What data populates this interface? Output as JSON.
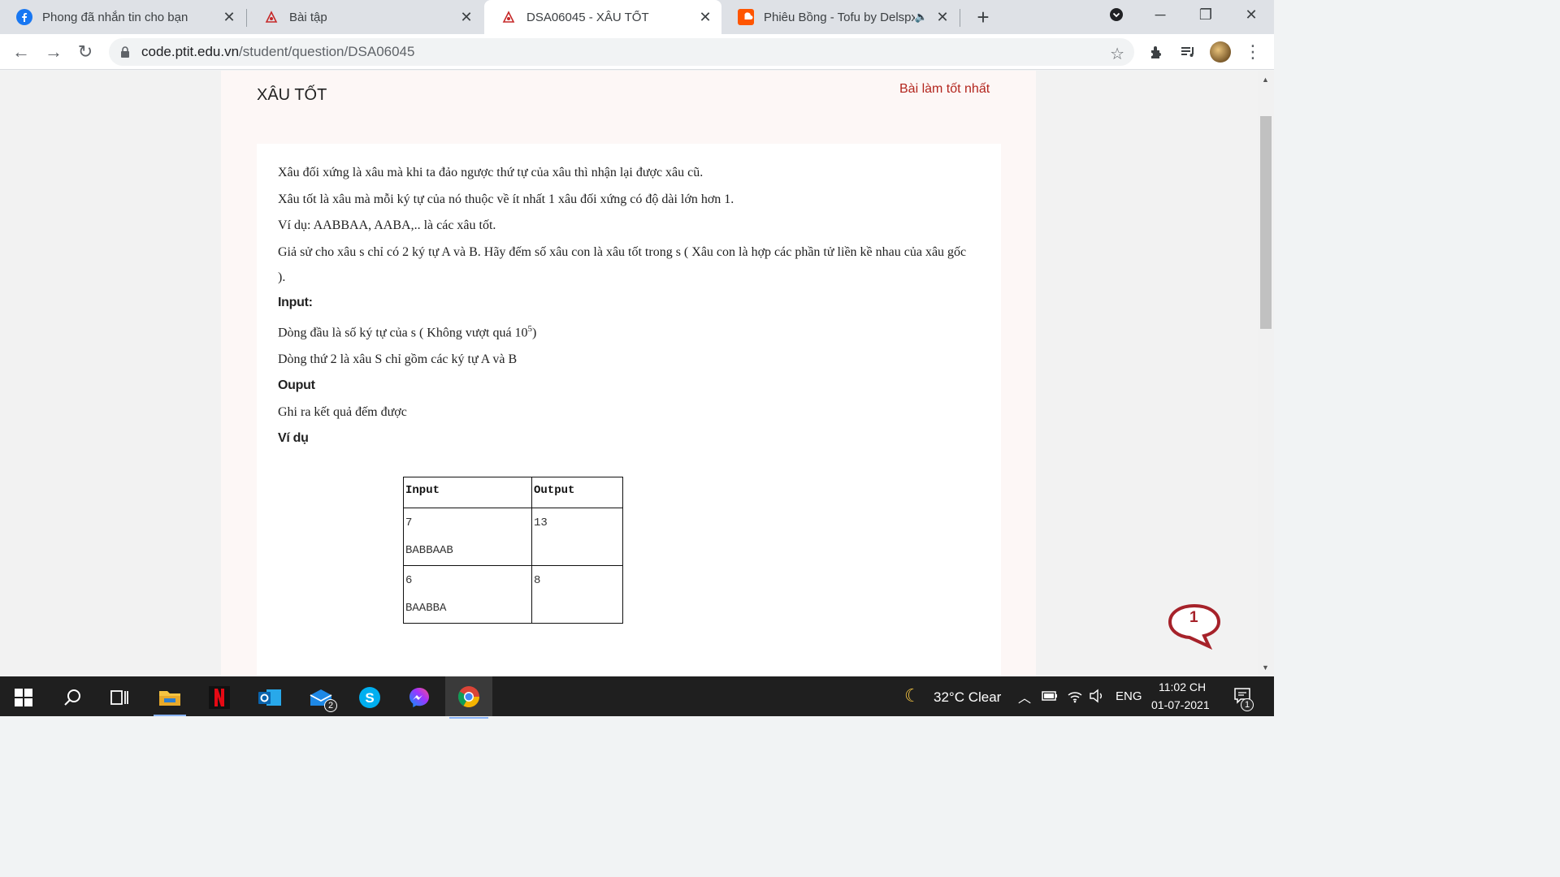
{
  "browser": {
    "tabs": [
      {
        "title": "Phong đã nhắn tin cho bạn",
        "icon": "facebook-icon"
      },
      {
        "title": "Bài tập",
        "icon": "ptit-icon"
      },
      {
        "title": "DSA06045 - XÂU TỐT",
        "icon": "ptit-icon",
        "active": true
      },
      {
        "title": "Phiêu Bồng - Tofu by Delspx",
        "icon": "soundcloud-icon"
      }
    ],
    "url_host": "code.ptit.edu.vn",
    "url_path": "/student/question/DSA06045"
  },
  "page": {
    "title": "XÂU TỐT",
    "best_link": "Bài làm tốt nhất",
    "paragraphs": {
      "p1": "Xâu đối xứng là xâu mà khi ta đảo ngược thứ tự của xâu thì nhận lại được xâu cũ.",
      "p2": "Xâu tốt là xâu mà mỗi ký tự của nó thuộc về ít nhất 1 xâu đối xứng có độ dài lớn hơn 1.",
      "p3": "Ví dụ: AABBAA,  AABA,.. là các xâu tốt.",
      "p4": "Giả sử cho xâu s chỉ có 2 ký tự A và B. Hãy đếm số xâu con là xâu tốt trong s ( Xâu con là hợp các phần tử liền kề nhau của xâu gốc )."
    },
    "input_heading": "Input:",
    "input_line1_pre": "Dòng đầu là số ký tự của s ( Không vượt quá 10",
    "input_line1_sup": "5",
    "input_line1_post": ")",
    "input_line2": "Dòng thứ 2 là xâu S chỉ gồm các ký tự A và B",
    "output_heading": "Ouput",
    "output_line": "Ghi ra kết quả đếm được",
    "example_heading": "Ví dụ",
    "table": {
      "headers": [
        "Input",
        "Output"
      ],
      "rows": [
        {
          "input": [
            "7",
            "BABBAAB"
          ],
          "output": "13"
        },
        {
          "input": [
            "6",
            "BAABBA"
          ],
          "output": "8"
        }
      ]
    },
    "chat_count": "1"
  },
  "taskbar": {
    "mail_badge": "2",
    "weather": "32°C  Clear",
    "language": "ENG",
    "time": "11:02 CH",
    "date": "01-07-2021",
    "notification_count": "1"
  },
  "colors": {
    "accent_red": "#b3261e",
    "tab_strip": "#dee1e6",
    "taskbar": "#1f1f1f"
  }
}
